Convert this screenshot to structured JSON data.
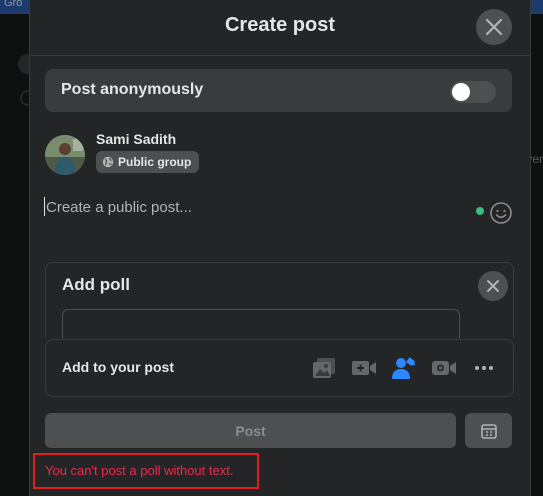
{
  "background": {
    "topbar_text": "Gro",
    "right_text": "ver"
  },
  "modal": {
    "title": "Create post",
    "close_icon": "close-icon"
  },
  "anonymous": {
    "label": "Post anonymously",
    "toggle_on": false
  },
  "author": {
    "name": "Sami Sadith",
    "audience": "Public group",
    "audience_icon": "globe-icon"
  },
  "composer": {
    "placeholder": "Create a public post..."
  },
  "poll": {
    "title": "Add poll"
  },
  "add_to_post": {
    "label": "Add to your post",
    "icons": [
      "photo-video-icon",
      "live-video-icon",
      "tag-people-icon",
      "video-room-icon",
      "more-icon"
    ]
  },
  "actions": {
    "post_label": "Post",
    "schedule_icon": "calendar-icon"
  },
  "error": {
    "message": "You can't post a poll without text."
  },
  "colors": {
    "modal_bg": "#242526",
    "surface": "#3a3b3c",
    "button_disabled": "#4e4f50",
    "accent_blue": "#2d88ff",
    "error_red": "#f02849",
    "green_dot": "#42b883"
  }
}
